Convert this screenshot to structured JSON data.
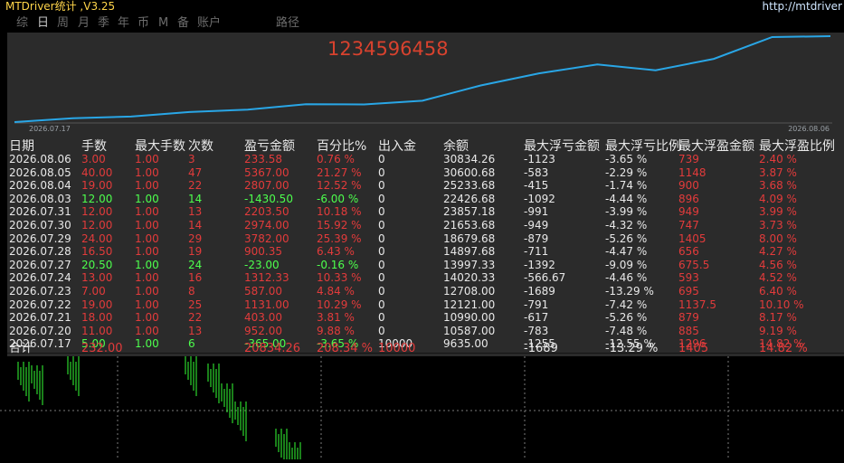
{
  "titlebar": {
    "title": "MTDriver统计  ,V3.25",
    "url": "http://mtdriver"
  },
  "toolbar": {
    "items": [
      "综",
      "日",
      "周",
      "月",
      "季",
      "年",
      "币",
      "M",
      "备",
      "账户",
      "路径"
    ],
    "active_index": 1
  },
  "chart": {
    "big_number": "1234596458",
    "start_date": "2026.07.17",
    "end_date": "2026.08.06",
    "line_color": "#29a6e6",
    "balance_series": [
      9635.0,
      10587.0,
      10990.0,
      12121.0,
      12708.0,
      14020.33,
      13997.33,
      14897.68,
      18679.68,
      21653.68,
      23857.18,
      22426.68,
      25233.68,
      30600.68,
      30834.26
    ]
  },
  "table": {
    "headers": [
      "日期",
      "手数",
      "最大手数",
      "次数",
      "盈亏金额",
      "百分比%",
      "出入金",
      "余额",
      "最大浮亏金额",
      "最大浮亏比例",
      "最大浮盈金额",
      "最大浮盈比例"
    ],
    "rows": [
      {
        "date": "2026.08.06",
        "lots": "3.00",
        "maxlots": "1.00",
        "count": "3",
        "pnl": "233.58",
        "pct": "0.76 %",
        "flow": "0",
        "balance": "30834.26",
        "maxloss": "-1123",
        "maxlosspct": "-3.65 %",
        "maxgain": "739",
        "maxgainpct": "2.40 %",
        "color": "red"
      },
      {
        "date": "2026.08.05",
        "lots": "40.00",
        "maxlots": "1.00",
        "count": "47",
        "pnl": "5367.00",
        "pct": "21.27 %",
        "flow": "0",
        "balance": "30600.68",
        "maxloss": "-583",
        "maxlosspct": "-2.29 %",
        "maxgain": "1148",
        "maxgainpct": "3.87 %",
        "color": "red"
      },
      {
        "date": "2026.08.04",
        "lots": "19.00",
        "maxlots": "1.00",
        "count": "22",
        "pnl": "2807.00",
        "pct": "12.52 %",
        "flow": "0",
        "balance": "25233.68",
        "maxloss": "-415",
        "maxlosspct": "-1.74 %",
        "maxgain": "900",
        "maxgainpct": "3.68 %",
        "color": "red"
      },
      {
        "date": "2026.08.03",
        "lots": "12.00",
        "maxlots": "1.00",
        "count": "14",
        "pnl": "-1430.50",
        "pct": "-6.00 %",
        "flow": "0",
        "balance": "22426.68",
        "maxloss": "-1092",
        "maxlosspct": "-4.44 %",
        "maxgain": "896",
        "maxgainpct": "4.09 %",
        "color": "green"
      },
      {
        "date": "2026.07.31",
        "lots": "12.00",
        "maxlots": "1.00",
        "count": "13",
        "pnl": "2203.50",
        "pct": "10.18 %",
        "flow": "0",
        "balance": "23857.18",
        "maxloss": "-991",
        "maxlosspct": "-3.99 %",
        "maxgain": "949",
        "maxgainpct": "3.99 %",
        "color": "red"
      },
      {
        "date": "2026.07.30",
        "lots": "12.00",
        "maxlots": "1.00",
        "count": "14",
        "pnl": "2974.00",
        "pct": "15.92 %",
        "flow": "0",
        "balance": "21653.68",
        "maxloss": "-949",
        "maxlosspct": "-4.32 %",
        "maxgain": "747",
        "maxgainpct": "3.73 %",
        "color": "red"
      },
      {
        "date": "2026.07.29",
        "lots": "24.00",
        "maxlots": "1.00",
        "count": "29",
        "pnl": "3782.00",
        "pct": "25.39 %",
        "flow": "0",
        "balance": "18679.68",
        "maxloss": "-879",
        "maxlosspct": "-5.26 %",
        "maxgain": "1405",
        "maxgainpct": "8.00 %",
        "color": "red"
      },
      {
        "date": "2026.07.28",
        "lots": "16.50",
        "maxlots": "1.00",
        "count": "19",
        "pnl": "900.35",
        "pct": "6.43 %",
        "flow": "0",
        "balance": "14897.68",
        "maxloss": "-711",
        "maxlosspct": "-4.47 %",
        "maxgain": "656",
        "maxgainpct": "4.27 %",
        "color": "red"
      },
      {
        "date": "2026.07.27",
        "lots": "20.50",
        "maxlots": "1.00",
        "count": "24",
        "pnl": "-23.00",
        "pct": "-0.16 %",
        "flow": "0",
        "balance": "13997.33",
        "maxloss": "-1392",
        "maxlosspct": "-9.09 %",
        "maxgain": "675.5",
        "maxgainpct": "4.56 %",
        "color": "green"
      },
      {
        "date": "2026.07.24",
        "lots": "13.00",
        "maxlots": "1.00",
        "count": "16",
        "pnl": "1312.33",
        "pct": "10.33 %",
        "flow": "0",
        "balance": "14020.33",
        "maxloss": "-566.67",
        "maxlosspct": "-4.46 %",
        "maxgain": "593",
        "maxgainpct": "4.52 %",
        "color": "red"
      },
      {
        "date": "2026.07.23",
        "lots": "7.00",
        "maxlots": "1.00",
        "count": "8",
        "pnl": "587.00",
        "pct": "4.84 %",
        "flow": "0",
        "balance": "12708.00",
        "maxloss": "-1689",
        "maxlosspct": "-13.29 %",
        "maxgain": "695",
        "maxgainpct": "6.40 %",
        "color": "red"
      },
      {
        "date": "2026.07.22",
        "lots": "19.00",
        "maxlots": "1.00",
        "count": "25",
        "pnl": "1131.00",
        "pct": "10.29 %",
        "flow": "0",
        "balance": "12121.00",
        "maxloss": "-791",
        "maxlosspct": "-7.42 %",
        "maxgain": "1137.5",
        "maxgainpct": "10.10 %",
        "color": "red"
      },
      {
        "date": "2026.07.21",
        "lots": "18.00",
        "maxlots": "1.00",
        "count": "22",
        "pnl": "403.00",
        "pct": "3.81 %",
        "flow": "0",
        "balance": "10990.00",
        "maxloss": "-617",
        "maxlosspct": "-5.26 %",
        "maxgain": "879",
        "maxgainpct": "8.17 %",
        "color": "red"
      },
      {
        "date": "2026.07.20",
        "lots": "11.00",
        "maxlots": "1.00",
        "count": "13",
        "pnl": "952.00",
        "pct": "9.88 %",
        "flow": "0",
        "balance": "10587.00",
        "maxloss": "-783",
        "maxlosspct": "-7.48 %",
        "maxgain": "885",
        "maxgainpct": "9.19 %",
        "color": "red"
      },
      {
        "date": "2026.07.17",
        "lots": "5.00",
        "maxlots": "1.00",
        "count": "6",
        "pnl": "-365.00",
        "pct": "-3.65 %",
        "flow": "10000",
        "balance": "9635.00",
        "maxloss": "-1255",
        "maxlosspct": "-12.55 %",
        "maxgain": "1296",
        "maxgainpct": "14.82 %",
        "color": "green"
      }
    ],
    "total": {
      "label": "合计",
      "lots": "232.00",
      "pnl": "20834.26",
      "pct": "208.34 %",
      "flow": "10000",
      "maxloss": "-1689",
      "maxlosspct": "-13.29 %",
      "maxgain": "1405",
      "maxgainpct": "14.82 %"
    }
  },
  "colors": {
    "profit": "#e23b3b",
    "loss": "#4dff4d",
    "panel": "#2b2b2b",
    "bars": "#33ff33"
  }
}
